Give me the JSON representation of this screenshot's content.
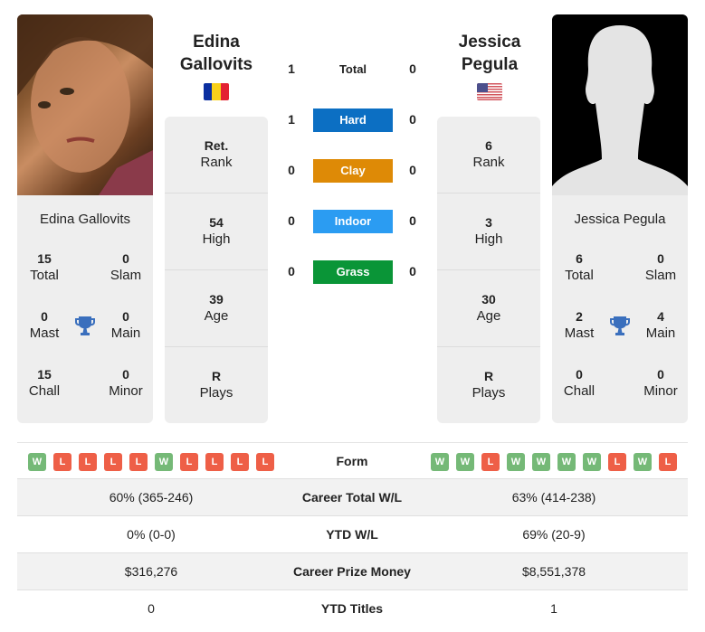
{
  "player1": {
    "name_line1": "Edina",
    "name_line2": "Gallovits",
    "full_name": "Edina Gallovits",
    "flag": "romania-flag",
    "titles": {
      "total": {
        "value": "15",
        "label": "Total"
      },
      "slam": {
        "value": "0",
        "label": "Slam"
      },
      "mast": {
        "value": "0",
        "label": "Mast"
      },
      "main": {
        "value": "0",
        "label": "Main"
      },
      "chall": {
        "value": "15",
        "label": "Chall"
      },
      "minor": {
        "value": "0",
        "label": "Minor"
      }
    },
    "info": [
      {
        "value": "Ret.",
        "label": "Rank"
      },
      {
        "value": "54",
        "label": "High"
      },
      {
        "value": "39",
        "label": "Age"
      },
      {
        "value": "R",
        "label": "Plays"
      }
    ],
    "form": [
      "W",
      "L",
      "L",
      "L",
      "L",
      "W",
      "L",
      "L",
      "L",
      "L"
    ]
  },
  "player2": {
    "name_line1": "Jessica",
    "name_line2": "Pegula",
    "full_name": "Jessica Pegula",
    "flag": "usa-flag",
    "titles": {
      "total": {
        "value": "6",
        "label": "Total"
      },
      "slam": {
        "value": "0",
        "label": "Slam"
      },
      "mast": {
        "value": "2",
        "label": "Mast"
      },
      "main": {
        "value": "4",
        "label": "Main"
      },
      "chall": {
        "value": "0",
        "label": "Chall"
      },
      "minor": {
        "value": "0",
        "label": "Minor"
      }
    },
    "info": [
      {
        "value": "6",
        "label": "Rank"
      },
      {
        "value": "3",
        "label": "High"
      },
      {
        "value": "30",
        "label": "Age"
      },
      {
        "value": "R",
        "label": "Plays"
      }
    ],
    "form": [
      "W",
      "W",
      "L",
      "W",
      "W",
      "W",
      "W",
      "L",
      "W",
      "L"
    ]
  },
  "h2h": [
    {
      "label": "Total",
      "p1": "1",
      "p2": "0",
      "color": ""
    },
    {
      "label": "Hard",
      "p1": "1",
      "p2": "0",
      "color": "#0c6fc3"
    },
    {
      "label": "Clay",
      "p1": "0",
      "p2": "0",
      "color": "#de8a06"
    },
    {
      "label": "Indoor",
      "p1": "0",
      "p2": "0",
      "color": "#2b9cf2"
    },
    {
      "label": "Grass",
      "p1": "0",
      "p2": "0",
      "color": "#0a9537"
    }
  ],
  "form_label": "Form",
  "stats": [
    {
      "label": "Career Total W/L",
      "p1": "60% (365-246)",
      "p2": "63% (414-238)"
    },
    {
      "label": "YTD W/L",
      "p1": "0% (0-0)",
      "p2": "69% (20-9)"
    },
    {
      "label": "Career Prize Money",
      "p1": "$316,276",
      "p2": "$8,551,378"
    },
    {
      "label": "YTD Titles",
      "p1": "0",
      "p2": "1"
    }
  ],
  "colors": {
    "win": "#75b977",
    "loss": "#ee5f47",
    "trophy": "#3a6fbd"
  }
}
